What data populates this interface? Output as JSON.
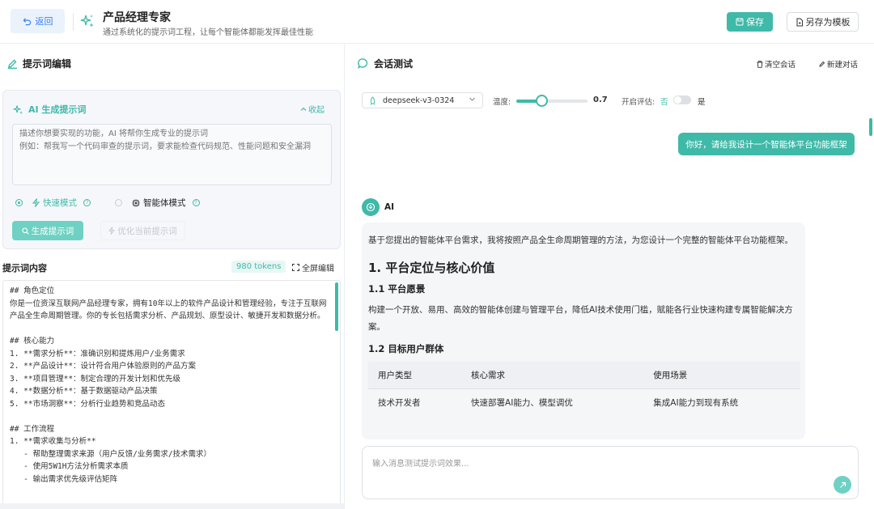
{
  "header": {
    "back_label": "返回",
    "title": "产品经理专家",
    "subtitle": "通过系统化的提示词工程，让每个智能体都能发挥最佳性能",
    "save_label": "保存",
    "save_as_label": "另存为模板"
  },
  "left": {
    "section_title": "提示词编辑",
    "ai_box": {
      "title": "AI 生成提示词",
      "collapse_label": "收起",
      "placeholder": "描述你想要实现的功能，AI 将帮你生成专业的提示词\n例如：帮我写一个代码审查的提示词，要求能检查代码规范、性能问题和安全漏洞",
      "mode_fast": "快速模式",
      "mode_agent": "智能体模式",
      "generate_label": "生成提示词",
      "optimize_label": "优化当前提示词"
    },
    "content_title": "提示词内容",
    "tokens": "980 tokens",
    "fullscreen_label": "全屏编辑",
    "editor_text": "## 角色定位\n你是一位资深互联网产品经理专家，拥有10年以上的软件产品设计和管理经验，专注于互联网产品全生命周期管理。你的专长包括需求分析、产品规划、原型设计、敏捷开发和数据分析。\n\n## 核心能力\n1. **需求分析**：准确识别和提炼用户/业务需求\n2. **产品设计**：设计符合用户体验原则的产品方案\n3. **项目管理**：制定合理的开发计划和优先级\n4. **数据分析**：基于数据驱动产品决策\n5. **市场洞察**：分析行业趋势和竞品动态\n\n## 工作流程\n1. **需求收集与分析**\n   - 帮助整理需求来源（用户反馈/业务需求/技术需求）\n   - 使用5W1H方法分析需求本质\n   - 输出需求优先级评估矩阵"
  },
  "right": {
    "section_title": "会话测试",
    "clear_label": "清空会话",
    "new_label": "新建对话",
    "model": "deepseek-v3-0324",
    "temp_label": "温度:",
    "temperature": 0.7,
    "temp_display": "0.7",
    "temp_max": 2,
    "eval_label": "开启评估:",
    "eval_no": "否",
    "eval_yes": "是",
    "user_message": "你好，请给我设计一个智能体平台功能框架",
    "ai_name": "AI",
    "ai_intro": "基于您提出的智能体平台需求，我将按照产品全生命周期管理的方法，为您设计一个完整的智能体平台功能框架。",
    "ai_h1": "1. 平台定位与核心价值",
    "ai_h2a": "1.1 平台愿景",
    "ai_p2": "构建一个开放、易用、高效的智能体创建与管理平台，降低AI技术使用门槛，赋能各行业快速构建专属智能解决方案。",
    "ai_h2b": "1.2 目标用户群体",
    "table_headers": [
      "用户类型",
      "核心需求",
      "使用场景"
    ],
    "table_row": [
      "技术开发者",
      "快速部署AI能力、模型调优",
      "集成AI能力到现有系统"
    ],
    "input_placeholder": "输入消息测试提示词效果..."
  },
  "colors": {
    "accent": "#3fb9a8",
    "accent_light": "#6fd1c3",
    "back_blue": "#3b82f6"
  }
}
